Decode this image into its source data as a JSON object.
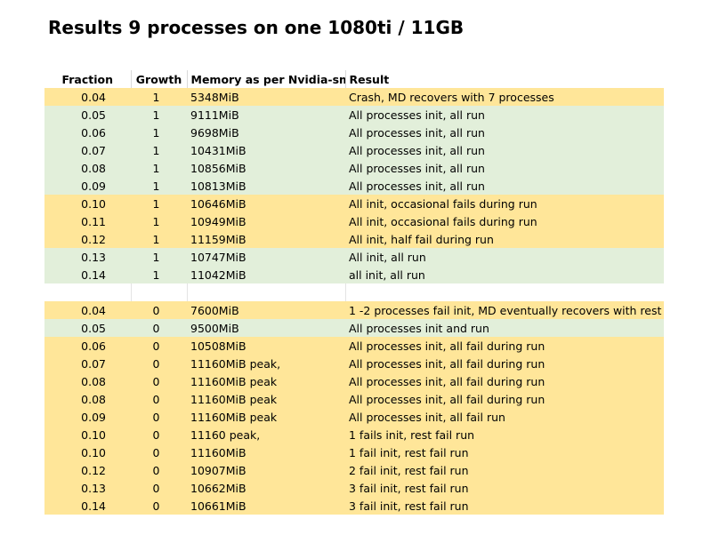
{
  "title": "Results 9 processes on one 1080ti / 11GB",
  "headers": [
    "Fraction",
    "Growth",
    "Memory as per Nvidia-smi",
    "Result"
  ],
  "rows": [
    {
      "fraction": "0.04",
      "growth": "1",
      "memory": " 5348MiB",
      "result": "Crash, MD recovers  with 7 processes",
      "color": "#ffe699"
    },
    {
      "fraction": "0.05",
      "growth": "1",
      "memory": "9111MiB",
      "result": "All processes init, all run",
      "color": "#e2efda"
    },
    {
      "fraction": "0.06",
      "growth": "1",
      "memory": "9698MiB",
      "result": "All processes init, all run",
      "color": "#e2efda"
    },
    {
      "fraction": "0.07",
      "growth": "1",
      "memory": "10431MiB",
      "result": "All processes init, all run",
      "color": "#e2efda"
    },
    {
      "fraction": "0.08",
      "growth": "1",
      "memory": "10856MiB",
      "result": "All processes init, all run",
      "color": "#e2efda"
    },
    {
      "fraction": "0.09",
      "growth": "1",
      "memory": "10813MiB",
      "result": "All processes init, all run",
      "color": "#e2efda"
    },
    {
      "fraction": "0.10",
      "growth": "1",
      "memory": "10646MiB",
      "result": "All init, occasional fails during run",
      "color": "#ffe699"
    },
    {
      "fraction": "0.11",
      "growth": "1",
      "memory": "10949MiB",
      "result": "All init, occasional fails during run",
      "color": "#ffe699"
    },
    {
      "fraction": "0.12",
      "growth": "1",
      "memory": "11159MiB",
      "result": "All init, half fail during run",
      "color": "#ffe699"
    },
    {
      "fraction": "0.13",
      "growth": "1",
      "memory": "10747MiB",
      "result": "All init, all run",
      "color": "#e2efda"
    },
    {
      "fraction": "0.14",
      "growth": "1",
      "memory": "11042MiB",
      "result": "all init, all run",
      "color": "#e2efda"
    },
    {
      "fraction": "",
      "growth": "",
      "memory": "",
      "result": "",
      "color": "#ffffff"
    },
    {
      "fraction": "0.04",
      "growth": "0",
      "memory": "7600MiB",
      "result": "1  -2 processes fail init, MD eventually recovers with rest",
      "color": "#ffe699"
    },
    {
      "fraction": "0.05",
      "growth": "0",
      "memory": "9500MiB",
      "result": "All processes init and run",
      "color": "#e2efda"
    },
    {
      "fraction": "0.06",
      "growth": "0",
      "memory": "10508MiB",
      "result": "All processes init, all fail during run",
      "color": "#ffe699"
    },
    {
      "fraction": "0.07",
      "growth": "0",
      "memory": "11160MiB peak,",
      "result": "All processes init, all fail during run",
      "color": "#ffe699"
    },
    {
      "fraction": "0.08",
      "growth": "0",
      "memory": "11160MiB peak",
      "result": "All processes init, all fail during run",
      "color": "#ffe699"
    },
    {
      "fraction": "0.08",
      "growth": "0",
      "memory": "11160MiB peak",
      "result": "All processes init, all fail during run",
      "color": "#ffe699"
    },
    {
      "fraction": "0.09",
      "growth": "0",
      "memory": "11160MiB peak",
      "result": "All processes init, all fail run",
      "color": "#ffe699"
    },
    {
      "fraction": "0.10",
      "growth": "0",
      "memory": "11160 peak,",
      "result": "1 fails init, rest fail run",
      "color": "#ffe699"
    },
    {
      "fraction": "0.10",
      "growth": "0",
      "memory": "11160MiB",
      "result": "1 fail init, rest fail run",
      "color": "#ffe699"
    },
    {
      "fraction": "0.12",
      "growth": "0",
      "memory": "10907MiB",
      "result": "2 fail init, rest fail run",
      "color": "#ffe699"
    },
    {
      "fraction": "0.13",
      "growth": "0",
      "memory": "10662MiB",
      "result": "3 fail init, rest fail run",
      "color": "#ffe699"
    },
    {
      "fraction": "0.14",
      "growth": "0",
      "memory": "10661MiB",
      "result": "3 fail init, rest fail run",
      "color": "#ffe699"
    }
  ]
}
